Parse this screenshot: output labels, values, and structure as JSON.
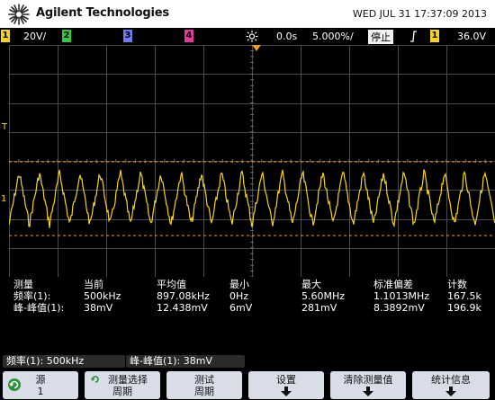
{
  "header": {
    "brand": "Agilent Technologies",
    "datetime": "WED JUL 31 17:37:09 2013"
  },
  "status_bar": {
    "channels": [
      {
        "number": "1",
        "scale": "20V/",
        "color": "#f6d518"
      },
      {
        "number": "2",
        "scale": "",
        "color": "#38c63a"
      },
      {
        "number": "3",
        "scale": "",
        "color": "#6d7cf0"
      },
      {
        "number": "4",
        "scale": "",
        "color": "#e63aa0"
      }
    ],
    "delay": "0.0s",
    "timebase": "5.000%/",
    "run_state": "停止",
    "trigger_channel": "1",
    "trigger_level": "36.0V"
  },
  "measurements": {
    "headers": [
      "测量",
      "当前",
      "平均值",
      "最小",
      "最大",
      "标准偏差",
      "计数"
    ],
    "rows": [
      {
        "label": "频率(1):",
        "current": "500kHz",
        "mean": "897.08kHz",
        "min": "0Hz",
        "max": "5.60MHz",
        "std_dev": "1.1013MHz",
        "count": "167.5k"
      },
      {
        "label": "峰-峰值(1):",
        "current": "38mV",
        "mean": "12.438mV",
        "min": "6mV",
        "max": "281mV",
        "std_dev": "8.3892mV",
        "count": "196.9k"
      }
    ]
  },
  "readouts": [
    {
      "text": "频率(1): 500kHz"
    },
    {
      "text": "峰-峰值(1): 38mV"
    }
  ],
  "softkeys": [
    {
      "line1": "源",
      "line2": "1",
      "icon": "rotate-knob-icon"
    },
    {
      "line1": "测量选择",
      "line2": "周期",
      "icon": "rotate-knob-icon"
    },
    {
      "line1": "测试",
      "line2": "周期"
    },
    {
      "line1": "设置",
      "line2": "",
      "icon": "arrow-down-icon"
    },
    {
      "line1": "清除测量值",
      "line2": "",
      "icon": "arrow-down-icon"
    },
    {
      "line1": "统计信息",
      "line2": "",
      "icon": "arrow-down-icon"
    }
  ],
  "colors": {
    "channel1": "#f6d518",
    "grid": "#4a4a4a",
    "cursor": "#e8a020",
    "softkey_bg": "#d9dde8",
    "run_state_bg": "#f2f2f2"
  },
  "waveform": {
    "channel": "1",
    "cycles": 24,
    "shape": "noisy-triangle"
  }
}
